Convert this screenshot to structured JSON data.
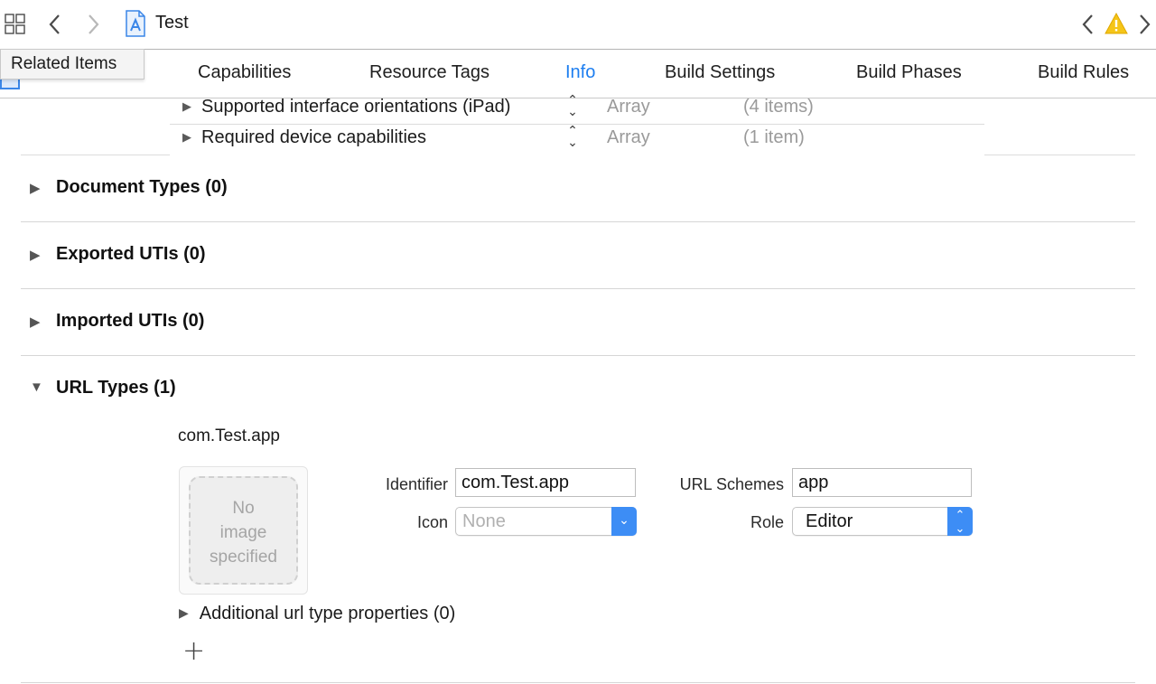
{
  "toolbar": {
    "related_items_icon": "grid-icon",
    "back_icon": "chevron-left-icon",
    "forward_icon": "chevron-right-icon",
    "file_icon": "project-file-icon",
    "file_title": "Test",
    "right_back_icon": "chevron-left-icon",
    "warning_icon": "warning-triangle-icon",
    "right_forward_icon": "chevron-right-icon",
    "warning_color": "#f5c518"
  },
  "tooltip": {
    "text": "Related Items"
  },
  "tabs": [
    {
      "label": "Capabilities"
    },
    {
      "label": "Resource Tags"
    },
    {
      "label": "Info",
      "active": true
    },
    {
      "label": "Build Settings"
    },
    {
      "label": "Build Phases"
    },
    {
      "label": "Build Rules"
    }
  ],
  "accent_color": "#1d7ef0",
  "plist_rows": [
    {
      "key": "Supported interface orientations (iPad)",
      "type": "Array",
      "value": "(4 items)"
    },
    {
      "key": "Required device capabilities",
      "type": "Array",
      "value": "(1 item)"
    }
  ],
  "sections": [
    {
      "title": "Document Types (0)",
      "expanded": false
    },
    {
      "title": "Exported UTIs (0)",
      "expanded": false
    },
    {
      "title": "Imported UTIs (0)",
      "expanded": false
    },
    {
      "title": "URL Types (1)",
      "expanded": true
    }
  ],
  "url_type": {
    "name": "com.Test.app",
    "image_placeholder": [
      "No",
      "image",
      "specified"
    ],
    "identifier_label": "Identifier",
    "identifier_value": "com.Test.app",
    "icon_label": "Icon",
    "icon_value": "None",
    "url_schemes_label": "URL Schemes",
    "url_schemes_value": "app",
    "role_label": "Role",
    "role_value": "Editor",
    "additional_label": "Additional url type properties (0)",
    "add_icon": "plus-icon"
  }
}
